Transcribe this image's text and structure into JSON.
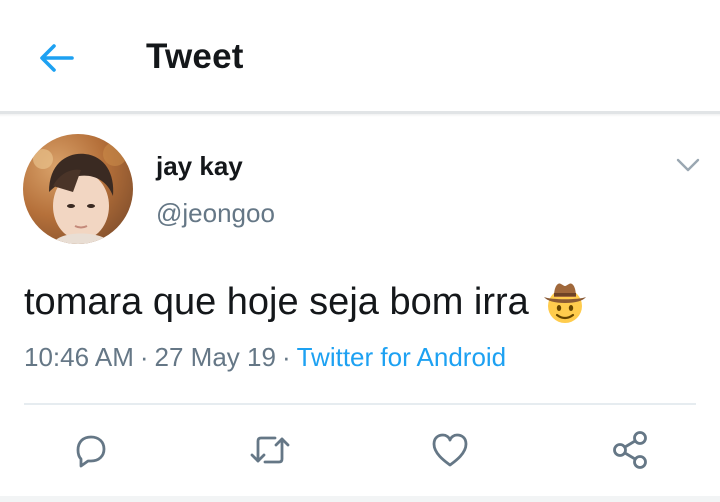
{
  "appbar": {
    "back_icon": "arrow-left-icon",
    "title": "Tweet"
  },
  "tweet": {
    "author": {
      "name": "jay kay",
      "handle": "@jeongoo",
      "avatar": "avatar-photo"
    },
    "menu_icon": "chevron-down-icon",
    "text": "tomara que hoje seja bom irra",
    "emoji": "cowboy-hat-face-emoji",
    "time": "10:46 AM",
    "separator": "·",
    "date": "27 May 19",
    "source": "Twitter for Android"
  },
  "actions": [
    {
      "name": "reply",
      "icon": "reply-icon"
    },
    {
      "name": "retweet",
      "icon": "retweet-icon"
    },
    {
      "name": "like",
      "icon": "heart-icon"
    },
    {
      "name": "share",
      "icon": "share-icon"
    }
  ],
  "colors": {
    "accent": "#1da1f2",
    "text": "#14171a",
    "secondary": "#657786",
    "divider": "#e1e4e6"
  }
}
